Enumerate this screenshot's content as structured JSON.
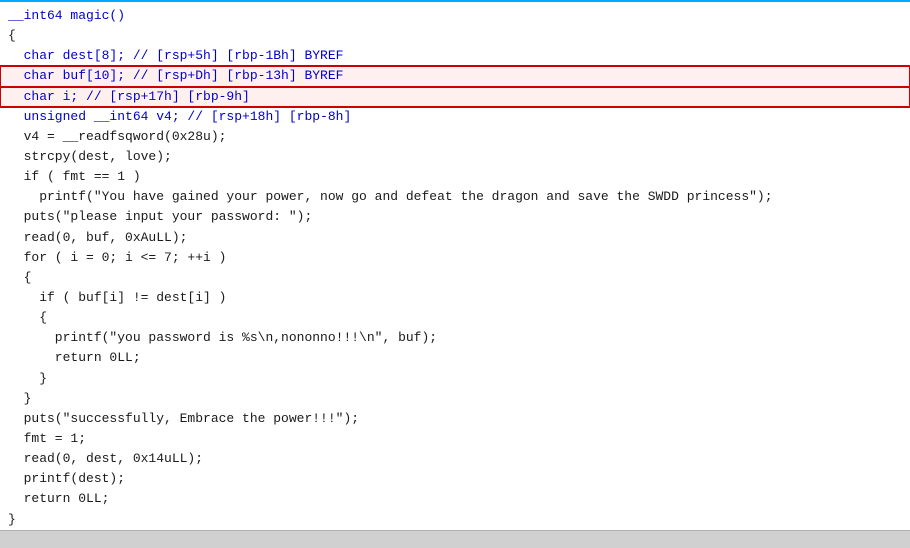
{
  "code": {
    "lines": [
      {
        "id": 1,
        "parts": [
          {
            "text": "__int64 magic()",
            "color": "c-blue"
          }
        ],
        "highlighted": false
      },
      {
        "id": 2,
        "parts": [
          {
            "text": "{",
            "color": "c-dark"
          }
        ],
        "highlighted": false
      },
      {
        "id": 3,
        "parts": [
          {
            "text": "  char dest[8]; // [rsp+5h] [rbp-1Bh] BYREF",
            "color": "c-blue"
          }
        ],
        "highlighted": false
      },
      {
        "id": 4,
        "parts": [
          {
            "text": "  char buf[10]; // [rsp+Dh] [rbp-13h] BYREF",
            "color": "c-blue"
          }
        ],
        "highlighted": true
      },
      {
        "id": 5,
        "parts": [
          {
            "text": "  char i; // [rsp+17h] [rbp-9h]",
            "color": "c-blue"
          }
        ],
        "highlighted": true
      },
      {
        "id": 6,
        "parts": [
          {
            "text": "  unsigned __int64 v4; // [rsp+18h] [rbp-8h]",
            "color": "c-blue"
          }
        ],
        "highlighted": false
      },
      {
        "id": 7,
        "parts": [
          {
            "text": "",
            "color": "c-dark"
          }
        ],
        "highlighted": false
      },
      {
        "id": 8,
        "parts": [
          {
            "text": "  v4 = __readfsqword(0x28u);",
            "color": "c-dark"
          }
        ],
        "highlighted": false
      },
      {
        "id": 9,
        "parts": [
          {
            "text": "  strcpy(dest, love);",
            "color": "c-dark"
          }
        ],
        "highlighted": false
      },
      {
        "id": 10,
        "parts": [
          {
            "text": "  if ( fmt == 1 )",
            "color": "c-dark"
          }
        ],
        "highlighted": false
      },
      {
        "id": 11,
        "parts": [
          {
            "text": "    printf(\"You have gained your power, now go and defeat the dragon and save the SWDD princess\");",
            "color": "c-dark"
          }
        ],
        "highlighted": false
      },
      {
        "id": 12,
        "parts": [
          {
            "text": "  puts(\"please input your password: \");",
            "color": "c-dark"
          }
        ],
        "highlighted": false
      },
      {
        "id": 13,
        "parts": [
          {
            "text": "  read(0, buf, 0xAuLL);",
            "color": "c-dark"
          }
        ],
        "highlighted": false
      },
      {
        "id": 14,
        "parts": [
          {
            "text": "  for ( i = 0; i <= 7; ++i )",
            "color": "c-dark"
          }
        ],
        "highlighted": false
      },
      {
        "id": 15,
        "parts": [
          {
            "text": "  {",
            "color": "c-dark"
          }
        ],
        "highlighted": false
      },
      {
        "id": 16,
        "parts": [
          {
            "text": "    if ( buf[i] != dest[i] )",
            "color": "c-dark"
          }
        ],
        "highlighted": false
      },
      {
        "id": 17,
        "parts": [
          {
            "text": "    {",
            "color": "c-dark"
          }
        ],
        "highlighted": false
      },
      {
        "id": 18,
        "parts": [
          {
            "text": "      printf(\"you password is %s\\n,nononno!!!\\n\", buf);",
            "color": "c-dark"
          }
        ],
        "highlighted": false
      },
      {
        "id": 19,
        "parts": [
          {
            "text": "      return 0LL;",
            "color": "c-dark"
          }
        ],
        "highlighted": false
      },
      {
        "id": 20,
        "parts": [
          {
            "text": "    }",
            "color": "c-dark"
          }
        ],
        "highlighted": false
      },
      {
        "id": 21,
        "parts": [
          {
            "text": "  }",
            "color": "c-dark"
          }
        ],
        "highlighted": false
      },
      {
        "id": 22,
        "parts": [
          {
            "text": "  puts(\"successfully, Embrace the power!!!\");",
            "color": "c-dark"
          }
        ],
        "highlighted": false
      },
      {
        "id": 23,
        "parts": [
          {
            "text": "  fmt = 1;",
            "color": "c-dark"
          }
        ],
        "highlighted": false
      },
      {
        "id": 24,
        "parts": [
          {
            "text": "  read(0, dest, 0x14uLL);",
            "color": "c-dark"
          }
        ],
        "highlighted": false
      },
      {
        "id": 25,
        "parts": [
          {
            "text": "  printf(dest);",
            "color": "c-dark"
          }
        ],
        "highlighted": false
      },
      {
        "id": 26,
        "parts": [
          {
            "text": "  return 0LL;",
            "color": "c-dark"
          }
        ],
        "highlighted": false
      },
      {
        "id": 27,
        "parts": [
          {
            "text": "}",
            "color": "c-dark"
          }
        ],
        "highlighted": false
      }
    ]
  }
}
